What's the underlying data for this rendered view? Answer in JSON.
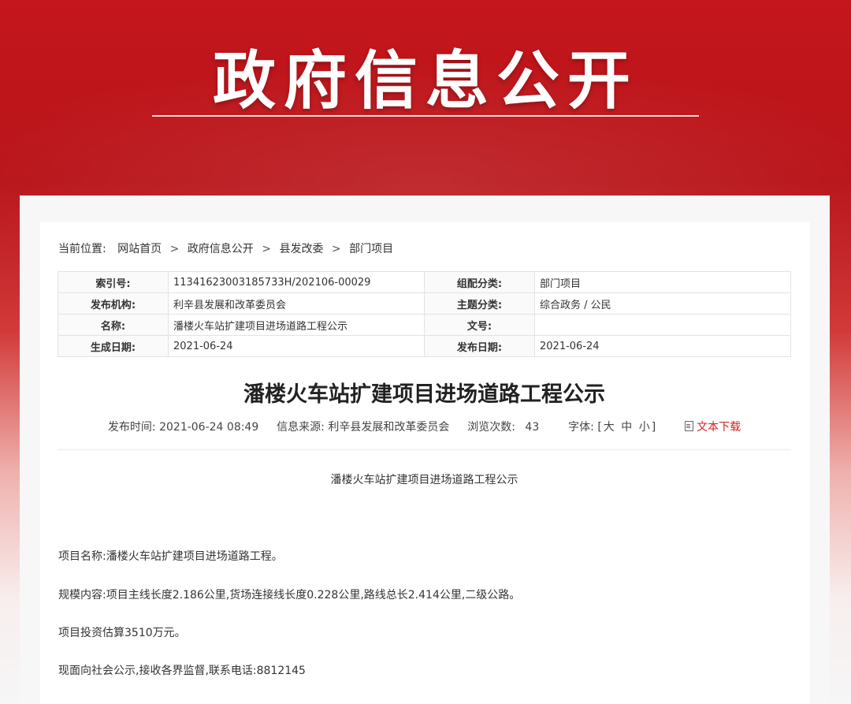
{
  "banner": {
    "title": "政府信息公开"
  },
  "breadcrumb": {
    "label": "当前位置:",
    "items": [
      "网站首页",
      "政府信息公开",
      "县发改委",
      "部门项目"
    ],
    "separator": ">"
  },
  "meta": {
    "rows": [
      {
        "k1": "索引号:",
        "v1": "11341623003185733H/202106-00029",
        "k2": "组配分类:",
        "v2": "部门项目"
      },
      {
        "k1": "发布机构:",
        "v1": "利辛县发展和改革委员会",
        "k2": "主题分类:",
        "v2": "综合政务 / 公民"
      },
      {
        "k1": "名称:",
        "v1": "潘楼火车站扩建项目进场道路工程公示",
        "k2": "文号:",
        "v2": ""
      },
      {
        "k1": "生成日期:",
        "v1": "2021-06-24",
        "k2": "发布日期:",
        "v2": "2021-06-24"
      }
    ]
  },
  "article": {
    "title": "潘楼火车站扩建项目进场道路工程公示",
    "publish_label": "发布时间:",
    "publish_time": "2021-06-24 08:49",
    "source_label": "信息来源:",
    "source": "利辛县发展和改革委员会",
    "views_label": "浏览次数:",
    "views": "43",
    "font_label": "字体:",
    "font_open": "[",
    "font_large": "大",
    "font_medium": "中",
    "font_small": "小",
    "font_close": "]",
    "download_label": "文本下载",
    "subtitle": "潘楼火车站扩建项目进场道路工程公示",
    "paragraphs": [
      "项目名称:潘楼火车站扩建项目进场道路工程。",
      "规模内容:项目主线长度2.186公里,货场连接线长度0.228公里,路线总长2.414公里,二级公路。",
      "项目投资估算3510万元。",
      "现面向社会公示,接收各界监督,联系电话:8812145"
    ]
  },
  "colors": {
    "banner_red": "#c4161c",
    "download_red": "#d21f1f"
  }
}
